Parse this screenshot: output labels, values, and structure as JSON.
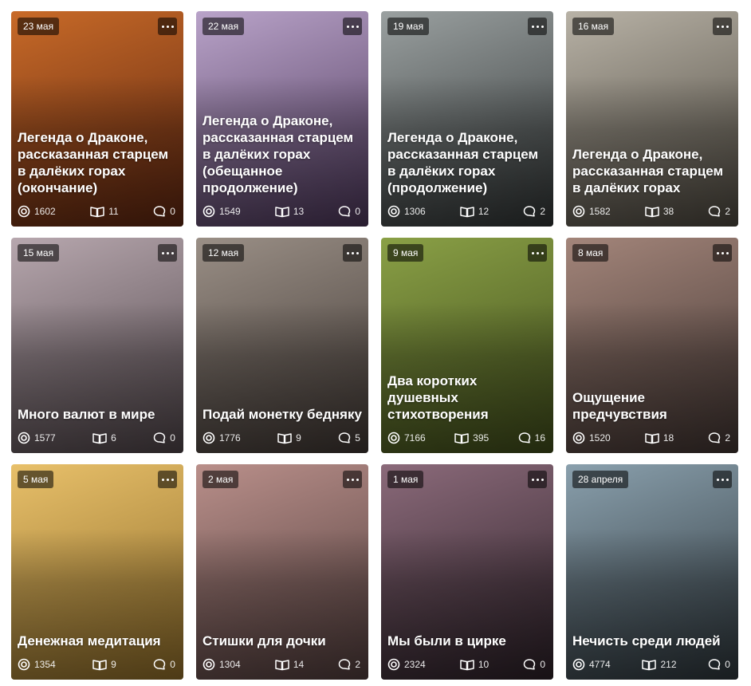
{
  "cards": [
    {
      "date": "23 мая",
      "title": "Легенда о Драконе, рассказанная старцем в далёких горах (окончание)",
      "views": "1602",
      "reads": "11",
      "comments": "0",
      "colors": [
        "#c86a28",
        "#5a2410"
      ]
    },
    {
      "date": "22 мая",
      "title": "Легенда о Драконе, рассказанная старцем в далёких горах (обещанное продолжение)",
      "views": "1549",
      "reads": "13",
      "comments": "0",
      "colors": [
        "#b9a3c9",
        "#4a3557"
      ]
    },
    {
      "date": "19 мая",
      "title": "Легенда о Драконе, рассказанная старцем в далёких горах (продолжение)",
      "views": "1306",
      "reads": "12",
      "comments": "2",
      "colors": [
        "#9aa0a0",
        "#2e3232"
      ]
    },
    {
      "date": "16 мая",
      "title": "Легенда о Драконе, рассказанная старцем в далёких горах",
      "views": "1582",
      "reads": "38",
      "comments": "2",
      "colors": [
        "#b8b2a6",
        "#4a453c"
      ]
    },
    {
      "date": "15 мая",
      "title": "Много валют в мире",
      "views": "1577",
      "reads": "6",
      "comments": "0",
      "colors": [
        "#b7a7ae",
        "#4d4347"
      ]
    },
    {
      "date": "12 мая",
      "title": "Подай монетку бедняку",
      "views": "1776",
      "reads": "9",
      "comments": "5",
      "colors": [
        "#9a8f86",
        "#3d3531"
      ]
    },
    {
      "date": "9 мая",
      "title": "Два коротких душевных стихотворения",
      "views": "7166",
      "reads": "395",
      "comments": "16",
      "colors": [
        "#8aa046",
        "#3e4a1a"
      ]
    },
    {
      "date": "8 мая",
      "title": "Ощущение предчувствия",
      "views": "1520",
      "reads": "18",
      "comments": "2",
      "colors": [
        "#a3857a",
        "#3f3330"
      ]
    },
    {
      "date": "5 мая",
      "title": "Денежная медитация",
      "views": "1354",
      "reads": "9",
      "comments": "0",
      "colors": [
        "#e8c06a",
        "#8c6a28"
      ]
    },
    {
      "date": "2 мая",
      "title": "Стишки для дочки",
      "views": "1304",
      "reads": "14",
      "comments": "2",
      "colors": [
        "#b98f8a",
        "#4e3b3a"
      ]
    },
    {
      "date": "1 мая",
      "title": "Мы были в цирке",
      "views": "2324",
      "reads": "10",
      "comments": "0",
      "colors": [
        "#8b6a7a",
        "#2a1f26"
      ]
    },
    {
      "date": "28 апреля",
      "title": "Нечисть среди людей",
      "views": "4774",
      "reads": "212",
      "comments": "0",
      "colors": [
        "#8aa0ad",
        "#2c3439"
      ]
    }
  ],
  "icons": {
    "views": "views-icon",
    "reads": "reads-icon",
    "comments": "comments-icon",
    "more": "more-icon"
  }
}
